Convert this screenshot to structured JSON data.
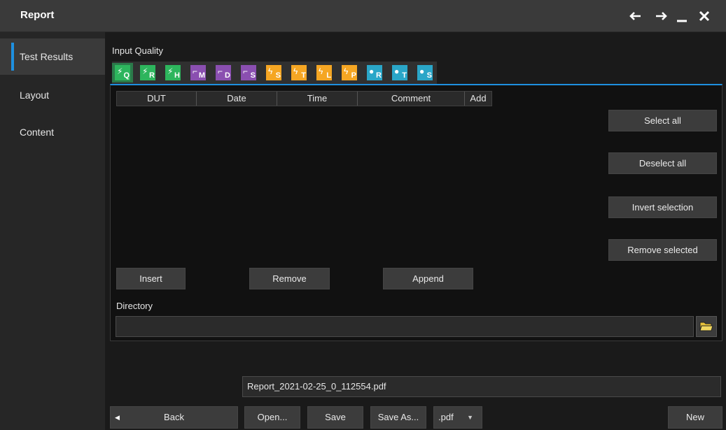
{
  "window": {
    "title": "Report",
    "controls": [
      "back-arrow-icon",
      "forward-arrow-icon",
      "minimize-icon",
      "close-icon"
    ]
  },
  "sidebar": {
    "items": [
      {
        "label": "Test Results",
        "active": true
      },
      {
        "label": "Layout",
        "active": false
      },
      {
        "label": "Content",
        "active": false
      }
    ]
  },
  "input_quality": {
    "label": "Input Quality",
    "tabs": [
      {
        "sub": "Q",
        "group": "power",
        "color": "#2db55d",
        "icon": "plug-icon",
        "selected": true
      },
      {
        "sub": "R",
        "group": "power",
        "color": "#2db55d",
        "icon": "plug-icon"
      },
      {
        "sub": "H",
        "group": "power",
        "color": "#2db55d",
        "icon": "plug-icon"
      },
      {
        "sub": "M",
        "group": "switch",
        "color": "#8a4fb0",
        "icon": "switch-icon"
      },
      {
        "sub": "D",
        "group": "switch",
        "color": "#8a4fb0",
        "icon": "switch-icon"
      },
      {
        "sub": "S",
        "group": "switch",
        "color": "#8a4fb0",
        "icon": "switch-icon"
      },
      {
        "sub": "S",
        "group": "ripple",
        "color": "#f5a623",
        "icon": "ripple-icon"
      },
      {
        "sub": "T",
        "group": "ripple",
        "color": "#f5a623",
        "icon": "ripple-icon"
      },
      {
        "sub": "L",
        "group": "ripple",
        "color": "#f5a623",
        "icon": "ripple-icon"
      },
      {
        "sub": "P",
        "group": "ripple",
        "color": "#f5a623",
        "icon": "ripple-icon"
      },
      {
        "sub": "R",
        "group": "bulb",
        "color": "#2aa6c8",
        "icon": "bulb-icon"
      },
      {
        "sub": "T",
        "group": "bulb",
        "color": "#2aa6c8",
        "icon": "bulb-icon"
      },
      {
        "sub": "S",
        "group": "bulb",
        "color": "#2aa6c8",
        "icon": "bulb-icon"
      }
    ]
  },
  "table": {
    "columns": [
      "DUT",
      "Date",
      "Time",
      "Comment",
      "Add"
    ],
    "rows": []
  },
  "actions": {
    "select_all": "Select all",
    "deselect_all": "Deselect all",
    "invert_selection": "Invert selection",
    "remove_selected": "Remove selected",
    "insert": "Insert",
    "remove": "Remove",
    "append": "Append"
  },
  "directory": {
    "label": "Directory",
    "value": ""
  },
  "footer": {
    "filename": "Report_2021-02-25_0_112554.pdf",
    "back": "Back",
    "open": "Open...",
    "save": "Save",
    "save_as": "Save As...",
    "format": ".pdf",
    "new": "New"
  },
  "colors": {
    "accent": "#1e90e0",
    "power": "#2db55d",
    "switch": "#8a4fb0",
    "ripple": "#f5a623",
    "bulb": "#2aa6c8"
  }
}
